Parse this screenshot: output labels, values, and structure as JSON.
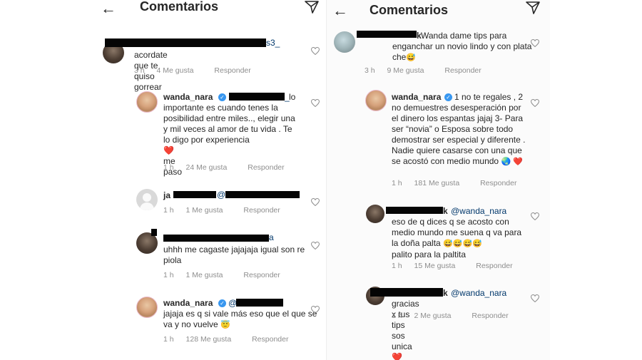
{
  "header": {
    "title": "Comentarios"
  },
  "left": {
    "comments": [
      {
        "user": "",
        "mention_tail": "s3_",
        "text": "acordate que te quiso gorrear",
        "time": "3 h",
        "likes": "4 Me gusta",
        "reply": "Responder"
      },
      {
        "user": "wanda_nara",
        "mention_tail": "_",
        "text_l1": "lo",
        "text": "importante es cuando tenes la posibilidad entre miles.., elegir una y mil veces al amor de tu vida . Te lo digo por experiencia",
        "text_end": "me paso",
        "heart_emoji": "❤️",
        "time": "1 h",
        "likes": "24 Me gusta",
        "reply": "Responder"
      },
      {
        "user": "ja",
        "mention_head": "@",
        "time": "1 h",
        "likes": "1 Me gusta",
        "reply": "Responder"
      },
      {
        "user": "",
        "mention_tail": "a",
        "text": "uhhh me cagaste jajajaja igual son re piola",
        "time": "1 h",
        "likes": "1 Me gusta",
        "reply": "Responder"
      },
      {
        "user": "wanda_nara",
        "mention_head": "@",
        "text": "jajaja es q si vale más eso que el que se va y no vuelve",
        "emoji": "😇",
        "time": "1 h",
        "likes": "128 Me gusta",
        "reply": "Responder"
      }
    ]
  },
  "right": {
    "comments": [
      {
        "user": "k",
        "text": "Wanda dame tips para enganchar un novio lindo y con plata che",
        "emoji": "😅",
        "time": "3 h",
        "likes": "9 Me gusta",
        "reply": "Responder"
      },
      {
        "user": "wanda_nara",
        "text": "1 no te regales , 2 no demuestres desesperación por el dinero los espantas jajaj 3- Para ser “novia” o Esposa sobre todo demostrar ser especial y diferente . Nadie quiere casarse con una que se acostó con medio mundo",
        "emoji": "🌏 ❤️",
        "time": "1 h",
        "likes": "181 Me gusta",
        "reply": "Responder"
      },
      {
        "user": "k",
        "mention": "@wanda_nara",
        "text": "eso de q dices q se acosto con medio mundo me suena q va para la doña palta",
        "emoji": "😅😅😅😅",
        "text_end": "palito para la paltita",
        "time": "1 h",
        "likes": "15 Me gusta",
        "reply": "Responder"
      },
      {
        "user": "k",
        "mention": "@wanda_nara",
        "text": "gracias x tus tips sos unica",
        "emoji": "❤️",
        "time": "1 h",
        "likes": "2 Me gusta",
        "reply": "Responder"
      }
    ]
  },
  "colors": {
    "text": "#262626",
    "meta": "#8e8e8e",
    "mention": "#00376b",
    "verified": "#3897f0",
    "heart": "#ed4956"
  },
  "icons": [
    "back-arrow-icon",
    "send-icon",
    "heart-outline-icon",
    "verified-icon"
  ]
}
